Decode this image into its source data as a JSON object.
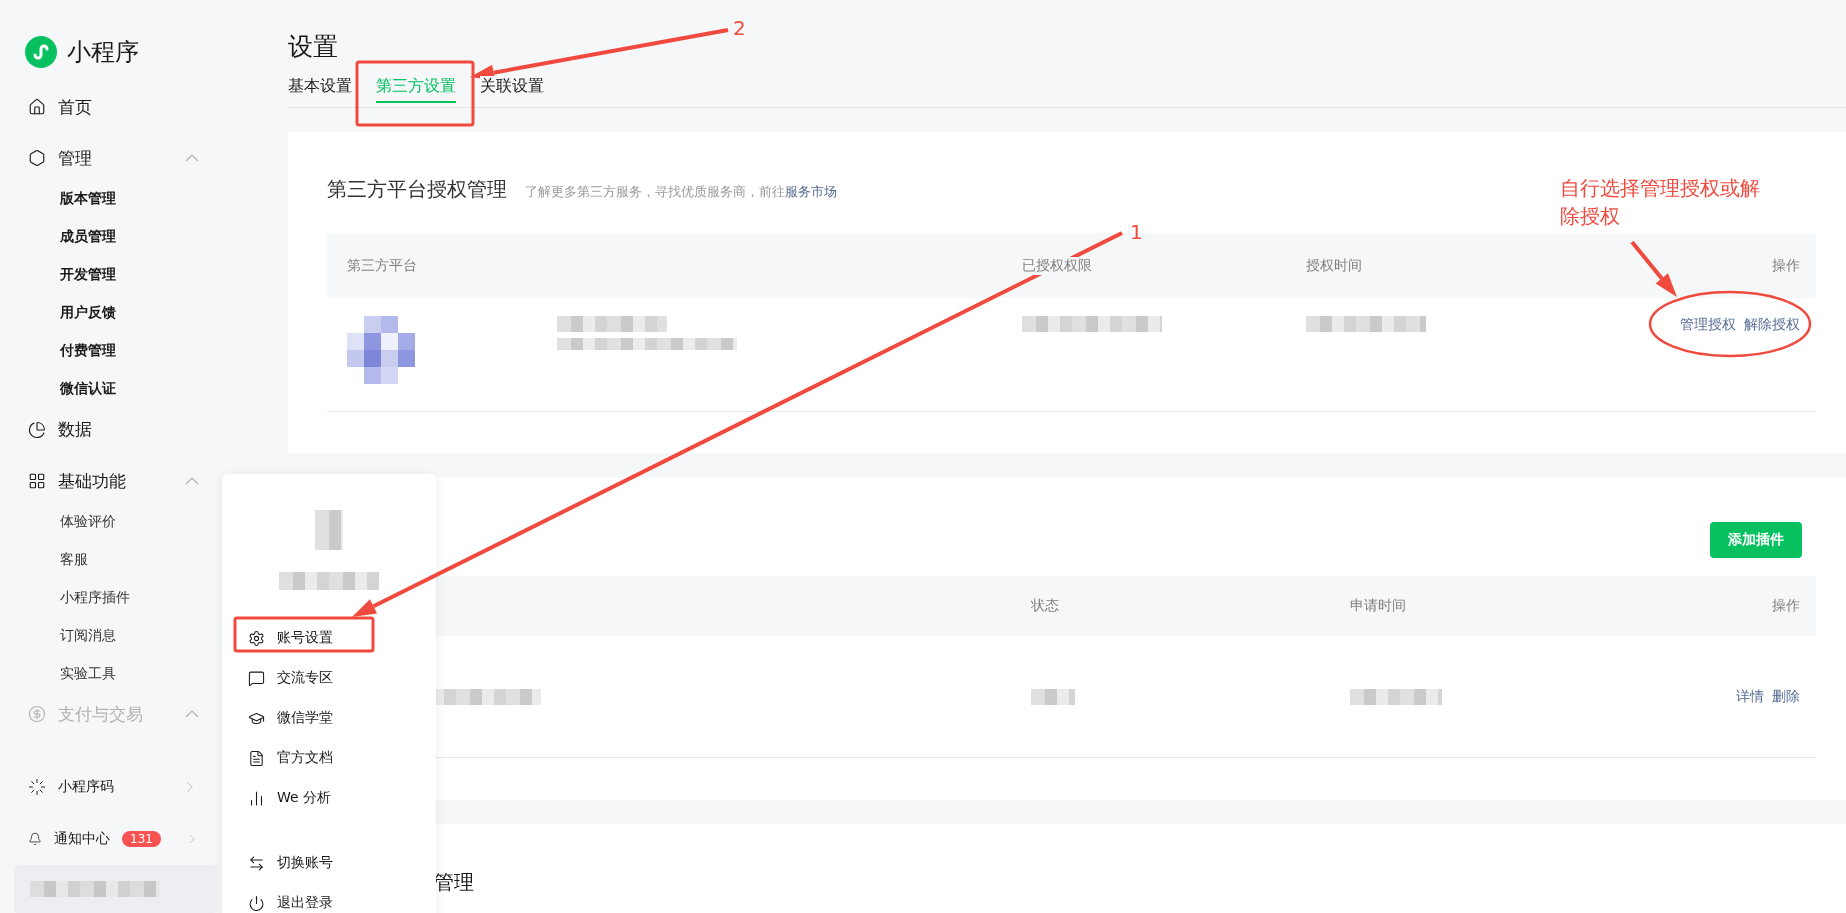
{
  "app": {
    "name": "小程序"
  },
  "nav": [
    {
      "kind": "link",
      "label": "首页",
      "disabled": false
    },
    {
      "kind": "group",
      "label": "管理",
      "expanded": true,
      "disabled": false,
      "children": [
        {
          "label": "版本管理",
          "strong": true
        },
        {
          "label": "成员管理",
          "strong": true
        },
        {
          "label": "开发管理",
          "strong": true
        },
        {
          "label": "用户反馈",
          "strong": true
        },
        {
          "label": "付费管理",
          "strong": true
        },
        {
          "label": "微信认证",
          "strong": true
        }
      ]
    },
    {
      "kind": "link",
      "label": "数据",
      "disabled": false
    },
    {
      "kind": "group",
      "label": "基础功能",
      "expanded": true,
      "disabled": false,
      "children": [
        {
          "label": "体验评价",
          "strong": false
        },
        {
          "label": "客服",
          "strong": false
        },
        {
          "label": "小程序插件",
          "strong": false
        },
        {
          "label": "订阅消息",
          "strong": false
        },
        {
          "label": "实验工具",
          "strong": false
        }
      ]
    },
    {
      "kind": "group",
      "label": "支付与交易",
      "expanded": true,
      "disabled": true
    }
  ],
  "shortcuts": [
    {
      "label": "小程序码"
    },
    {
      "label": "通知中心",
      "badge": "131"
    }
  ],
  "page": {
    "title": "设置",
    "tabs": [
      {
        "label": "基本设置",
        "selected": false
      },
      {
        "label": "第三方设置",
        "selected": true
      },
      {
        "label": "关联设置",
        "selected": false
      }
    ]
  },
  "auth_card": {
    "title": "第三方平台授权管理",
    "hint": "了解更多第三方服务，寻找优质服务商，前往",
    "hint_link": "服务市场",
    "columns": [
      "第三方平台",
      "已授权权限",
      "授权时间",
      "操作"
    ],
    "rows": [
      {
        "actions": [
          "管理授权",
          "解除授权"
        ]
      }
    ]
  },
  "plugin_card": {
    "button": "添加插件",
    "columns": [
      "状态",
      "申请时间",
      "操作"
    ],
    "rows": [
      {
        "actions": [
          "详情",
          "删除"
        ]
      }
    ]
  },
  "third_card": {
    "title_fragment": "管理"
  },
  "account_menu": {
    "items": [
      {
        "label": "账号设置"
      },
      {
        "label": "交流专区"
      },
      {
        "label": "微信学堂"
      },
      {
        "label": "官方文档"
      },
      {
        "label": "We 分析"
      }
    ],
    "footer_items": [
      {
        "label": "切换账号"
      },
      {
        "label": "退出登录"
      }
    ]
  },
  "annotations": {
    "labels": [
      "2",
      "1"
    ],
    "note": "自行选择管理授权或解除授权"
  }
}
